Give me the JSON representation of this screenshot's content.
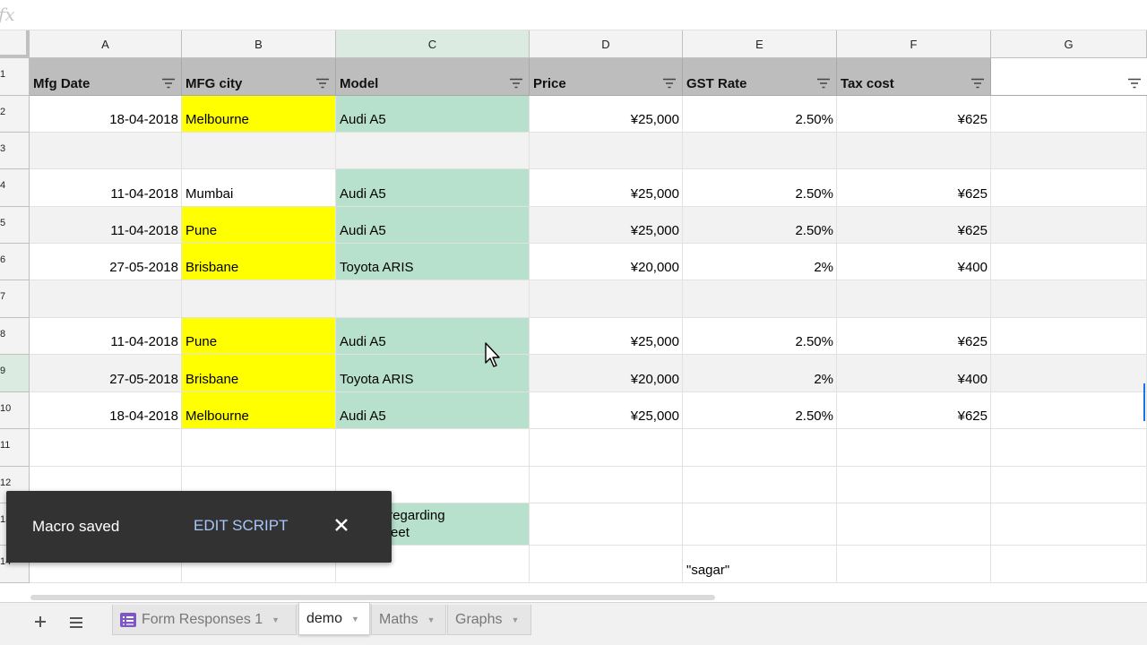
{
  "formula_bar": {
    "fx_label": "fx"
  },
  "columns": [
    "A",
    "B",
    "C",
    "D",
    "E",
    "F",
    "G"
  ],
  "rows": [
    "1",
    "2",
    "3",
    "4",
    "5",
    "6",
    "7",
    "8",
    "9",
    "10",
    "11",
    "12",
    "13",
    "14"
  ],
  "header_row": [
    "Mfg Date",
    "MFG city",
    "Model",
    "Price",
    "GST Rate",
    "Tax cost",
    ""
  ],
  "data_rows": [
    {
      "date": "18-04-2018",
      "city": "Melbourne",
      "model": "Audi A5",
      "price": "¥25,000",
      "gst": "2.50%",
      "tax": "¥625"
    },
    {
      "date": "",
      "city": "",
      "model": "",
      "price": "",
      "gst": "",
      "tax": ""
    },
    {
      "date": "11-04-2018",
      "city": "Mumbai",
      "model": "Audi A5",
      "price": "¥25,000",
      "gst": "2.50%",
      "tax": "¥625"
    },
    {
      "date": "11-04-2018",
      "city": "Pune",
      "model": "Audi A5",
      "price": "¥25,000",
      "gst": "2.50%",
      "tax": "¥625"
    },
    {
      "date": "27-05-2018",
      "city": "Brisbane",
      "model": "Toyota ARIS",
      "price": "¥20,000",
      "gst": "2%",
      "tax": "¥400"
    },
    {
      "date": "",
      "city": "",
      "model": "",
      "price": "",
      "gst": "",
      "tax": ""
    },
    {
      "date": "11-04-2018",
      "city": "Pune",
      "model": "Audi A5",
      "price": "¥25,000",
      "gst": "2.50%",
      "tax": "¥625"
    },
    {
      "date": "27-05-2018",
      "city": "Brisbane",
      "model": "Toyota ARIS",
      "price": "¥20,000",
      "gst": "2%",
      "tax": "¥400"
    },
    {
      "date": "18-04-2018",
      "city": "Melbourne",
      "model": "Audi A5",
      "price": "¥25,000",
      "gst": "2.50%",
      "tax": "¥625"
    }
  ],
  "note_cell": {
    "line1": "a demo regarding",
    "line2": "ey\" in sheet"
  },
  "e14_value": "\"sagar\"",
  "toast": {
    "message": "Macro saved",
    "action": "EDIT SCRIPT"
  },
  "sheet_tabs": [
    {
      "label": "Form Responses 1",
      "active": false
    },
    {
      "label": "demo",
      "active": true
    },
    {
      "label": "Maths",
      "active": false
    },
    {
      "label": "Graphs",
      "active": false
    }
  ],
  "colors": {
    "header_gray": "#bdbdbd",
    "city_yellow": "#ffff00",
    "model_green": "#b7e1cd",
    "toast_bg": "#323232"
  },
  "icons": {
    "filter": "filter-icon",
    "add_sheet": "plus-icon",
    "all_sheets": "list-icon",
    "close": "close-icon",
    "form": "form-icon"
  }
}
